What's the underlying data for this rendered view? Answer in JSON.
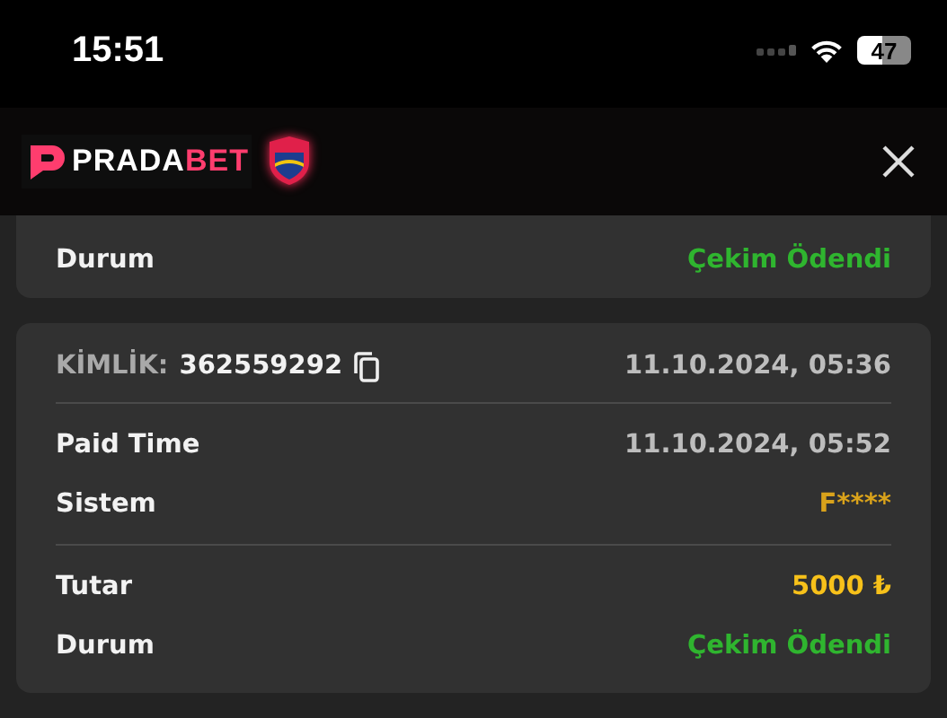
{
  "status_bar": {
    "time": "15:51",
    "battery": "47"
  },
  "header": {
    "logo": {
      "first": "PRADA",
      "second": "BET"
    }
  },
  "cards": [
    {
      "clipped": true,
      "groups": [
        [
          {
            "label": "Durum",
            "value": "Çekim Ödendi",
            "kind": "status"
          }
        ]
      ]
    },
    {
      "clipped": false,
      "id_label": "KİMLİK:",
      "id_value": "362559292",
      "date": "11.10.2024, 05:36",
      "groups": [
        [
          {
            "label": "Paid Time",
            "value": "11.10.2024, 05:52",
            "kind": "plain"
          },
          {
            "label": "Sistem",
            "value": "F****",
            "kind": "system"
          }
        ],
        [
          {
            "label": "Tutar",
            "value": "5000 ₺",
            "kind": "amount"
          },
          {
            "label": "Durum",
            "value": "Çekim Ödendi",
            "kind": "status"
          }
        ]
      ]
    }
  ]
}
